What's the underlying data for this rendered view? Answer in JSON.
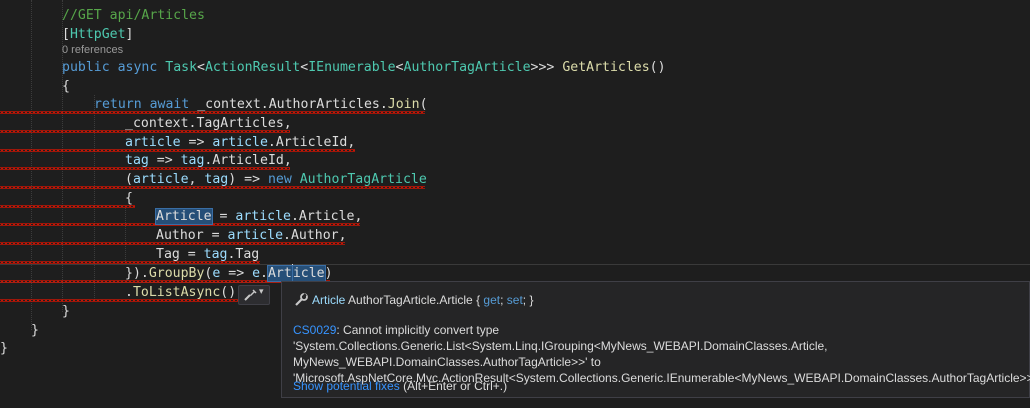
{
  "editor": {
    "code_lens": "0 references",
    "lines": [
      [
        {
          "t": "//GET api/Articles",
          "c": "comment"
        }
      ],
      [
        {
          "t": "[",
          "c": "plain"
        },
        {
          "t": "HttpGet",
          "c": "attr"
        },
        {
          "t": "]",
          "c": "plain"
        }
      ],
      [],
      [
        {
          "t": "public",
          "c": "kw"
        },
        {
          "t": " ",
          "c": "plain"
        },
        {
          "t": "async",
          "c": "kw"
        },
        {
          "t": " ",
          "c": "plain"
        },
        {
          "t": "Task",
          "c": "type"
        },
        {
          "t": "<",
          "c": "plain"
        },
        {
          "t": "ActionResult",
          "c": "type"
        },
        {
          "t": "<",
          "c": "plain"
        },
        {
          "t": "IEnumerable",
          "c": "type"
        },
        {
          "t": "<",
          "c": "plain"
        },
        {
          "t": "AuthorTagArticle",
          "c": "type"
        },
        {
          "t": ">>> ",
          "c": "plain"
        },
        {
          "t": "GetArticles",
          "c": "method"
        },
        {
          "t": "()",
          "c": "plain"
        }
      ],
      [
        {
          "t": "{",
          "c": "plain"
        }
      ],
      [
        {
          "t": "return",
          "c": "kw"
        },
        {
          "t": " ",
          "c": "plain"
        },
        {
          "t": "await",
          "c": "kw"
        },
        {
          "t": " _context.AuthorArticles.",
          "c": "plain"
        },
        {
          "t": "Join",
          "c": "method"
        },
        {
          "t": "(",
          "c": "plain"
        }
      ],
      [
        {
          "t": "_context.TagArticles,",
          "c": "plain"
        }
      ],
      [
        {
          "t": "article",
          "c": "ident"
        },
        {
          "t": " => ",
          "c": "plain"
        },
        {
          "t": "article",
          "c": "ident"
        },
        {
          "t": ".ArticleId,",
          "c": "plain"
        }
      ],
      [
        {
          "t": "tag",
          "c": "ident"
        },
        {
          "t": " => ",
          "c": "plain"
        },
        {
          "t": "tag",
          "c": "ident"
        },
        {
          "t": ".ArticleId,",
          "c": "plain"
        }
      ],
      [
        {
          "t": "(",
          "c": "plain"
        },
        {
          "t": "article",
          "c": "ident"
        },
        {
          "t": ", ",
          "c": "plain"
        },
        {
          "t": "tag",
          "c": "ident"
        },
        {
          "t": ") => ",
          "c": "plain"
        },
        {
          "t": "new",
          "c": "kw"
        },
        {
          "t": " ",
          "c": "plain"
        },
        {
          "t": "AuthorTagArticle",
          "c": "type"
        }
      ],
      [
        {
          "t": "{",
          "c": "plain"
        }
      ],
      [
        {
          "t": "Article",
          "c": "plain",
          "sel": true
        },
        {
          "t": " = ",
          "c": "plain"
        },
        {
          "t": "article",
          "c": "ident"
        },
        {
          "t": ".Article,",
          "c": "plain"
        }
      ],
      [
        {
          "t": "Author",
          "c": "plain"
        },
        {
          "t": " = ",
          "c": "plain"
        },
        {
          "t": "article",
          "c": "ident"
        },
        {
          "t": ".Author,",
          "c": "plain"
        }
      ],
      [
        {
          "t": "Tag",
          "c": "plain"
        },
        {
          "t": " = ",
          "c": "plain"
        },
        {
          "t": "tag",
          "c": "ident"
        },
        {
          "t": ".Tag",
          "c": "plain"
        }
      ],
      [
        {
          "t": "}).",
          "c": "plain"
        },
        {
          "t": "GroupBy",
          "c": "method"
        },
        {
          "t": "(",
          "c": "plain"
        },
        {
          "t": "e",
          "c": "ident"
        },
        {
          "t": " => ",
          "c": "plain"
        },
        {
          "t": "e",
          "c": "ident"
        },
        {
          "t": ".",
          "c": "plain"
        },
        {
          "t": "Art",
          "c": "plain",
          "sel": true,
          "caret": true
        },
        {
          "t": "icle",
          "c": "plain",
          "sel": true
        },
        {
          "t": ")",
          "c": "plain"
        }
      ],
      [
        {
          "t": ".",
          "c": "plain"
        },
        {
          "t": "ToListAsync",
          "c": "method"
        },
        {
          "t": "()",
          "c": "plain"
        }
      ],
      [
        {
          "t": "}",
          "c": "plain"
        }
      ],
      [
        {
          "t": "}",
          "c": "plain"
        }
      ],
      [
        {
          "t": "}",
          "c": "plain"
        }
      ]
    ]
  },
  "quick_actions": {
    "icon": "screwdriver-icon",
    "chevron": "▾"
  },
  "tooltip": {
    "signature": {
      "icon": "wrench-icon",
      "name": "Article",
      "rest": " AuthorTagArticle.Article { ",
      "get": "get",
      "sep": "; ",
      "set": "set",
      "end": "; }"
    },
    "error": {
      "code": "CS0029",
      "message": ": Cannot implicitly convert type 'System.Collections.Generic.List<System.Linq.IGrouping<MyNews_WEBAPI.DomainClasses.Article, MyNews_WEBAPI.DomainClasses.AuthorTagArticle>>' to 'Microsoft.AspNetCore.Mvc.ActionResult<System.Collections.Generic.IEnumerable<MyNews_WEBAPI.DomainClasses.AuthorTagArticle>>'"
    },
    "fix_link": "Show potential fixes",
    "fix_shortcut": " (Alt+Enter or Ctrl+.)"
  },
  "colors": {
    "background": "#1e1e1e",
    "comment": "#57a64a",
    "keyword": "#569cd6",
    "type": "#4ec9b0",
    "method": "#dcdcaa",
    "identifier": "#9cdcfe",
    "error_squiggle": "#e51400",
    "link": "#3794ff"
  }
}
